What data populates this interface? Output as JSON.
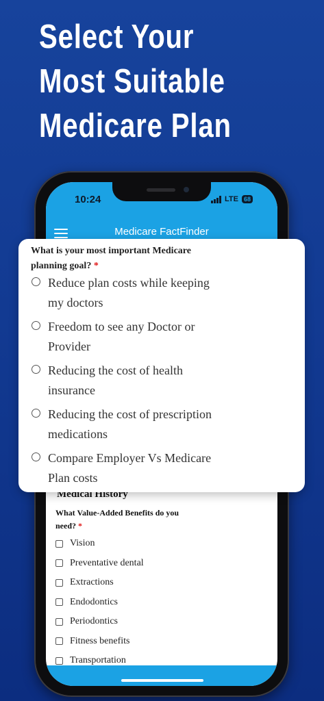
{
  "headline": [
    "Select Your",
    "Most Suitable",
    "Medicare Plan"
  ],
  "status_bar": {
    "time": "10:24",
    "network": "LTE",
    "battery": "68"
  },
  "app": {
    "title": "Medicare FactFinder"
  },
  "card": {
    "question": "What is your most important Medicare planning goal?",
    "required_mark": "*",
    "options": [
      "Reduce plan costs while keeping my doctors",
      "Freedom to see any Doctor or Provider",
      "Reducing the cost of health insurance",
      "Reducing the cost of prescription medications",
      "Compare Employer Vs Medicare Plan costs"
    ]
  },
  "form": {
    "section_title": "Medical History",
    "question": "What Value-Added Benefits do you need?",
    "required_mark": "*",
    "benefits": [
      "Vision",
      "Preventative dental",
      "Extractions",
      "Endodontics",
      "Periodontics",
      "Fitness benefits",
      "Transportation"
    ]
  }
}
